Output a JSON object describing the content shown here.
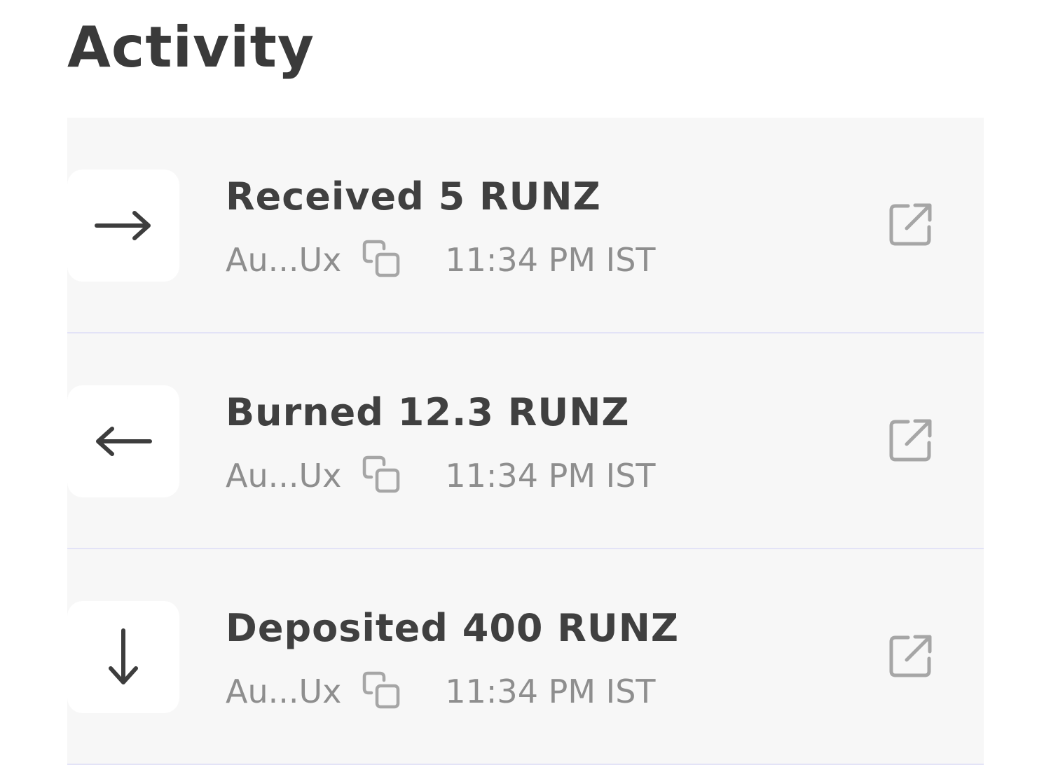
{
  "header": {
    "title": "Activity"
  },
  "activities": [
    {
      "title": "Received 5 RUNZ",
      "direction_icon": "arrow-right-icon",
      "address": "Au...Ux",
      "time": "11:34 PM IST"
    },
    {
      "title": "Burned 12.3 RUNZ",
      "direction_icon": "arrow-left-icon",
      "address": "Au...Ux",
      "time": "11:34 PM IST"
    },
    {
      "title": "Deposited 400 RUNZ",
      "direction_icon": "arrow-down-icon",
      "address": "Au...Ux",
      "time": "11:34 PM IST"
    }
  ],
  "colors": {
    "title": "#3a3a3a",
    "row_title": "#404040",
    "secondary_text": "#8e8e8e",
    "icon_muted": "#a6a6a6",
    "list_background": "#f7f7f7",
    "tile_background": "#ffffff",
    "divider": "#e3e3f7"
  }
}
